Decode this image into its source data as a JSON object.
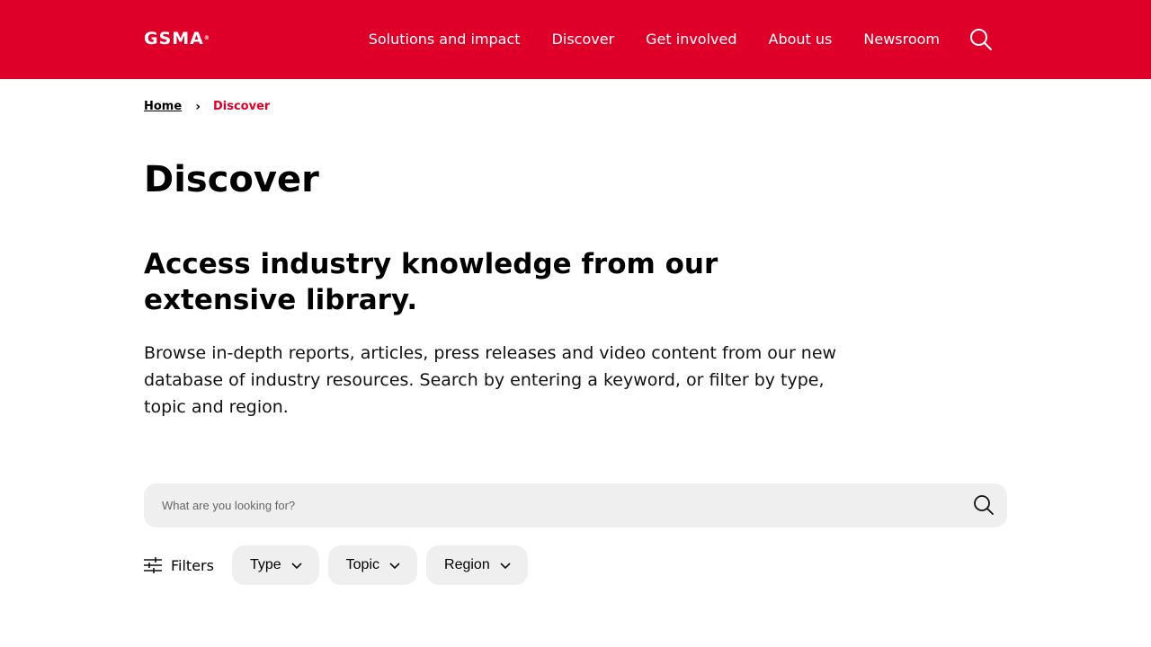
{
  "header": {
    "logo": "GSMA",
    "nav": [
      "Solutions and impact",
      "Discover",
      "Get involved",
      "About us",
      "Newsroom"
    ],
    "search_icon": "search-icon",
    "background_color": "#de0029"
  },
  "breadcrumb": {
    "home": "Home",
    "separator": "›",
    "current": "Discover"
  },
  "main": {
    "title": "Discover",
    "heading": "Access industry knowledge from our extensive library.",
    "intro": "Browse in-depth reports, articles, press releases and video content from our new database of industry resources. Search by entering a keyword, or filter by type, topic and region."
  },
  "search": {
    "placeholder": "What are you looking for?",
    "value": ""
  },
  "filters": {
    "label": "Filters",
    "dropdowns": [
      "Type",
      "Topic",
      "Region"
    ]
  }
}
